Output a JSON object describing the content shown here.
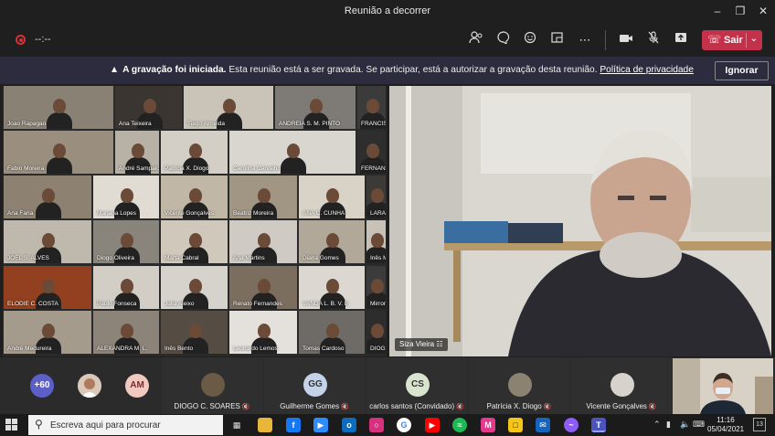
{
  "window": {
    "title": "Reunião a decorrer"
  },
  "toolbar": {
    "timer": "--:--",
    "leave_label": "Sair"
  },
  "banner": {
    "bold": "A gravação foi iniciada.",
    "text": " Esta reunião está a ser gravada. Se participar, está a autorizar a gravação desta reunião. ",
    "link": "Política de privacidade",
    "ignore_label": "Ignorar"
  },
  "gallery": [
    {
      "name": "Joao Rapagao",
      "bg": "#8a8175"
    },
    {
      "name": "Ana Teixeira",
      "bg": "#3a3530"
    },
    {
      "name": "Tiago Almeida",
      "bg": "#c9c3b8"
    },
    {
      "name": "ANDREIA S. M. PINTO",
      "bg": "#7e7a75"
    },
    {
      "name": "FRANCIS",
      "bg": "#3b3b3b"
    },
    {
      "name": "Fabio Moreira",
      "bg": "#9a8e7e"
    },
    {
      "name": "André Sampaio",
      "bg": "#b7b1a6"
    },
    {
      "name": "Patricia X. Diogo",
      "bg": "#d4cfc6"
    },
    {
      "name": "Carolina Carvalho",
      "bg": "#d9d6d0"
    },
    {
      "name": "FERNANDO",
      "bg": "#2e2e2e"
    },
    {
      "name": "Ana Faria",
      "bg": "#8d8272"
    },
    {
      "name": "Mariana Lopes",
      "bg": "#e0dcd4"
    },
    {
      "name": "Vicente Gonçalves",
      "bg": "#c0b7a6"
    },
    {
      "name": "Beatriz Moreira",
      "bg": "#a19584"
    },
    {
      "name": "ANA C. CUNHA",
      "bg": "#d8d2c7"
    },
    {
      "name": "LARA",
      "bg": "#3c3a36"
    },
    {
      "name": "JOEL S. ALVES",
      "bg": "#bfb8ad"
    },
    {
      "name": "Diogo Oliveira",
      "bg": "#8a857c"
    },
    {
      "name": "Marta Cabral",
      "bg": "#d0c8ba"
    },
    {
      "name": "Ana Martins",
      "bg": "#cfcbc4"
    },
    {
      "name": "Diana Gomes",
      "bg": "#b1a899"
    },
    {
      "name": "Inês M",
      "bg": "#c7c1b6"
    },
    {
      "name": "ELODIE C. COSTA",
      "bg": "#92401f"
    },
    {
      "name": "Paulo Fonseca",
      "bg": "#d2cec6"
    },
    {
      "name": "Julia Aleixo",
      "bg": "#d6d3cd"
    },
    {
      "name": "Renato Fernandes",
      "bg": "#7b6e5e"
    },
    {
      "name": "VANDA L. B. V. E.",
      "bg": "#dcd8d1"
    },
    {
      "name": "Mirror",
      "bg": "#3b3b3b"
    },
    {
      "name": "André Medureira",
      "bg": "#a59b8c"
    },
    {
      "name": "ALEXANDRA M. L.",
      "bg": "#8c8478"
    },
    {
      "name": "Inês Bento",
      "bg": "#554c44"
    },
    {
      "name": "Leonardo Lemos",
      "bg": "#e4e1dc"
    },
    {
      "name": "Tomas Cardoso",
      "bg": "#6e6a65"
    },
    {
      "name": "DIOG",
      "bg": "#2d2d2d"
    }
  ],
  "speaker": {
    "name": "Siza Vieira"
  },
  "strip": {
    "overflow_count": "+60",
    "am_initials": "AM",
    "people": [
      {
        "name": "DIOGO C. SOARES",
        "initials": "",
        "color": "#6b5a45"
      },
      {
        "name": "Guilherme Gomes",
        "initials": "GG",
        "color": "#c5d3ea"
      },
      {
        "name": "carlos santos (Convidado)",
        "initials": "CS",
        "color": "#d9e4cf"
      },
      {
        "name": "Patrícia X. Diogo",
        "initials": "",
        "color": "#8b8272"
      },
      {
        "name": "Vicente Gonçalves",
        "initials": "",
        "color": "#d7d3cc"
      }
    ]
  },
  "taskbar": {
    "search_placeholder": "Escreva aqui para procurar",
    "time": "11:16",
    "date": "05/04/2021",
    "notif_count": "13"
  }
}
